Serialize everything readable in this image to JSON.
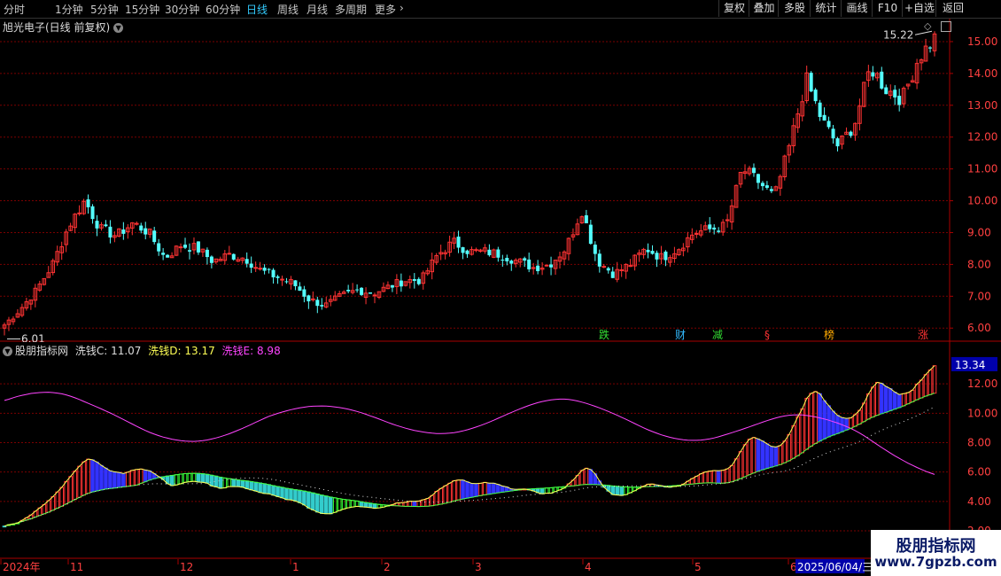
{
  "toolbar": {
    "tabs": [
      {
        "label": "分时",
        "active": false
      },
      {
        "label": "1分钟",
        "active": false
      },
      {
        "label": "5分钟",
        "active": false
      },
      {
        "label": "15分钟",
        "active": false
      },
      {
        "label": "30分钟",
        "active": false
      },
      {
        "label": "60分钟",
        "active": false
      },
      {
        "label": "日线",
        "active": true
      },
      {
        "label": "周线",
        "active": false
      },
      {
        "label": "月线",
        "active": false
      },
      {
        "label": "多周期",
        "active": false
      },
      {
        "label": "更多",
        "active": false
      }
    ],
    "more_glyph": "›",
    "right_buttons": [
      "复权",
      "叠加",
      "多股",
      "统计",
      "画线",
      "F10",
      "+自选",
      "返回"
    ]
  },
  "main_panel": {
    "title": "旭光电子(日线 前复权)",
    "y_ticks": [
      "15.00",
      "14.00",
      "13.00",
      "12.00",
      "11.00",
      "10.00",
      "9.00",
      "8.00",
      "7.00",
      "6.00"
    ],
    "high_label": "15.22",
    "low_label": "6.01",
    "markers": [
      {
        "text": "跌",
        "color": "#33dd33"
      },
      {
        "text": "财",
        "color": "#33bbff"
      },
      {
        "text": "减",
        "color": "#33dd33"
      },
      {
        "text": "§",
        "color": "#ff3333"
      },
      {
        "text": "榜",
        "color": "#ffaa00"
      },
      {
        "text": "涨",
        "color": "#ff3333"
      }
    ]
  },
  "indicator_panel": {
    "name": "股朋指标网",
    "series": [
      {
        "label": "洗钱C: 11.07",
        "color": "#dddddd"
      },
      {
        "label": "洗钱D: 13.17",
        "color": "#ffff55"
      },
      {
        "label": "洗钱E: 8.98",
        "color": "#ff44ff"
      }
    ],
    "current_value": "13.34",
    "y_ticks": [
      "12.00",
      "10.00",
      "8.00",
      "6.00",
      "4.00",
      "2.00"
    ]
  },
  "time_axis": {
    "labels": [
      "2024年",
      "11",
      "12",
      "1",
      "2",
      "3",
      "4",
      "5",
      "6"
    ],
    "cursor_date": "2025/06/04/三"
  },
  "watermark": {
    "title": "股朋指标网",
    "url": "www.7gpzb.com"
  },
  "colors": {
    "up": "#ff3333",
    "down": "#54ffff",
    "grid": "#7a0000",
    "accent": "#33ccff"
  },
  "chart_data": {
    "type": "candlestick",
    "title": "旭光电子(日线 前复权)",
    "ylim": [
      5.7,
      15.5
    ],
    "x_labels": [
      "2024年",
      "11",
      "12",
      "1",
      "2",
      "3",
      "4",
      "5",
      "6"
    ],
    "price_close_anchors": [
      6.1,
      6.6,
      7.2,
      8.0,
      9.2,
      10.0,
      9.1,
      8.9,
      9.3,
      9.0,
      8.2,
      8.6,
      8.5,
      8.1,
      8.3,
      8.2,
      7.8,
      7.6,
      7.4,
      6.9,
      6.7,
      7.0,
      7.2,
      7.1,
      7.3,
      7.5,
      7.5,
      8.3,
      8.7,
      8.4,
      8.4,
      8.3,
      8.1,
      7.9,
      8.0,
      8.5,
      9.7,
      8.1,
      7.7,
      8.0,
      8.5,
      8.2,
      8.5,
      9.0,
      9.1,
      9.2,
      11.0,
      10.6,
      10.1,
      11.8,
      13.8,
      12.5,
      11.7,
      12.4,
      14.2,
      13.5,
      13.2,
      14.5,
      15.1
    ],
    "indicator_series": [
      {
        "name": "洗钱C",
        "last": 11.07
      },
      {
        "name": "洗钱D",
        "last": 13.17
      },
      {
        "name": "洗钱E",
        "last": 8.98
      }
    ]
  }
}
